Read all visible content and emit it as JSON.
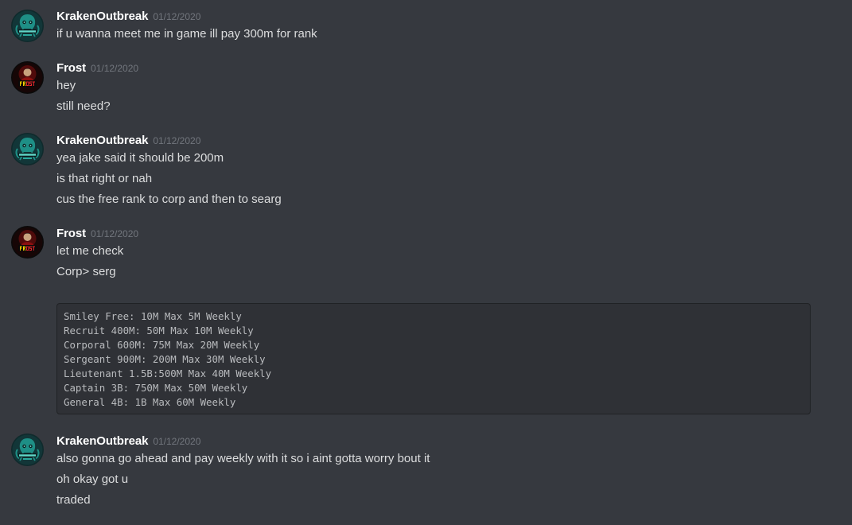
{
  "messages": [
    {
      "author": "KrakenOutbreak",
      "timestamp": "01/12/2020",
      "avatar_icon": "kraken-logo-icon",
      "lines": [
        "if u wanna meet me in game ill pay 300m for rank"
      ]
    },
    {
      "author": "Frost",
      "timestamp": "01/12/2020",
      "avatar_icon": "frost-logo-icon",
      "lines": [
        "hey",
        "still need?"
      ]
    },
    {
      "author": "KrakenOutbreak",
      "timestamp": "01/12/2020",
      "avatar_icon": "kraken-logo-icon",
      "lines": [
        "yea jake said it should be 200m",
        "is that right or nah",
        "cus the free rank to corp and then to searg"
      ]
    },
    {
      "author": "Frost",
      "timestamp": "01/12/2020",
      "avatar_icon": "frost-logo-icon",
      "lines": [
        "let me check",
        "Corp> serg"
      ],
      "code_block": [
        "Smiley Free: 10M Max 5M Weekly",
        "Recruit 400M: 50M Max 10M Weekly",
        "Corporal 600M: 75M Max 20M Weekly",
        "Sergeant 900M: 200M Max 30M Weekly",
        "Lieutenant 1.5B:500M Max 40M Weekly",
        "Captain 3B: 750M Max 50M Weekly",
        "General 4B: 1B Max 60M Weekly"
      ]
    },
    {
      "author": "KrakenOutbreak",
      "timestamp": "01/12/2020",
      "avatar_icon": "kraken-logo-icon",
      "lines": [
        "also gonna go ahead and pay weekly with it so i aint gotta worry bout it",
        "oh okay got u",
        "traded"
      ]
    }
  ],
  "colors": {
    "background": "#36393f",
    "username": "#ffffff",
    "timestamp": "#72767d",
    "message_text": "#dcddde",
    "code_background": "#2f3136",
    "code_text": "#b9bbbe"
  }
}
